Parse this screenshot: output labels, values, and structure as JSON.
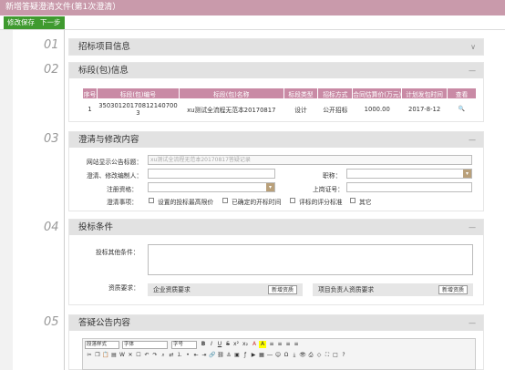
{
  "window": {
    "title": "新增答疑澄清文件(第1次澄清）"
  },
  "toolbar": {
    "save_label": "修改保存",
    "next_label": "下一步"
  },
  "steps": [
    {
      "num": "01",
      "title": "招标项目信息",
      "ctl": "∨"
    },
    {
      "num": "02",
      "title": "标段(包)信息",
      "ctl": "—"
    },
    {
      "num": "03",
      "title": "澄清与修改内容",
      "ctl": "—"
    },
    {
      "num": "04",
      "title": "投标条件",
      "ctl": "—"
    },
    {
      "num": "05",
      "title": "答疑公告内容",
      "ctl": "—"
    }
  ],
  "bid_table": {
    "headers": [
      "序号",
      "标段(包)编号",
      "标段(包)名称",
      "标段类型",
      "招标方式",
      "合同估算价(万元)",
      "计划发包时间",
      "查看"
    ],
    "rows": [
      {
        "index": "1",
        "code": "35030120170812140700 3",
        "name": "xu测试全流程无范本20170817",
        "type": "设计",
        "method": "公开招标",
        "price": "1000.00",
        "date": "2017-8-12",
        "view": "🔍"
      }
    ]
  },
  "clarify": {
    "site_title_label": "网站显示公告标题：",
    "site_title_value": "xu测试全流程无范本20170817答疑记录",
    "editor_label": "澄清、修改编制人：",
    "title_label": "职称：",
    "reg_label": "注册资格：",
    "cert_label": "上岗证号：",
    "items_label": "澄清事项：",
    "items": [
      "设置的投标最高限价",
      "已确定的开标时间",
      "评标的评分标准",
      "其它"
    ]
  },
  "conditions": {
    "other_label": "投标其他条件：",
    "qual_label": "资质要求：",
    "company_qual": "企业资质要求",
    "pm_qual": "项目负责人资质要求",
    "add_label": "新增资质"
  },
  "editor": {
    "paragraph_select": "段落样式",
    "font_select": "字体",
    "size_select": "字号"
  }
}
